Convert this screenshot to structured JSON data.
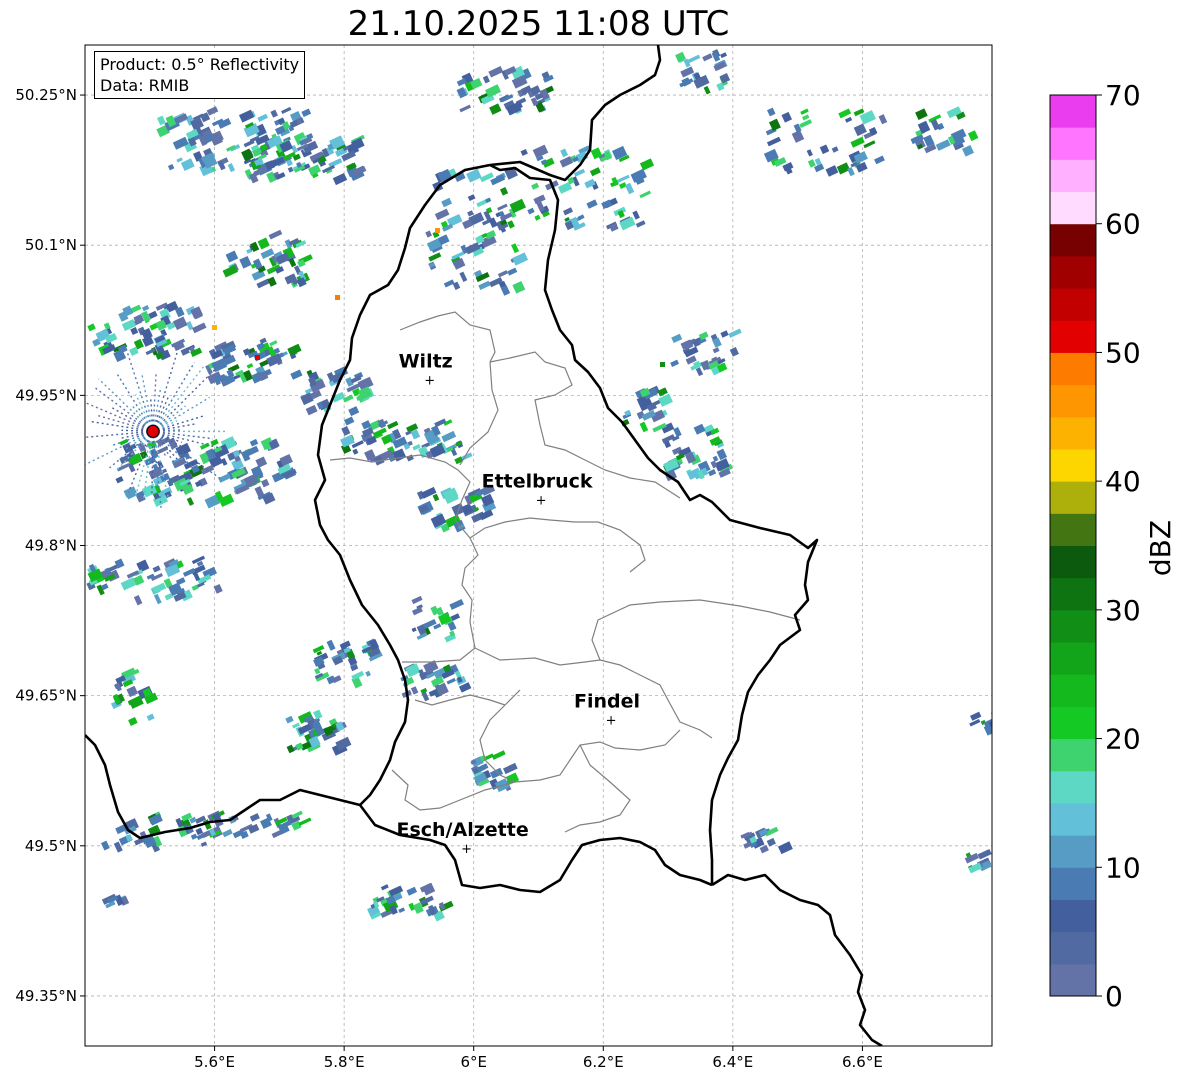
{
  "title": "21.10.2025 11:08 UTC",
  "info": {
    "product": "Product: 0.5° Reflectivity",
    "source": "Data: RMIB"
  },
  "map": {
    "lon_range": [
      5.4,
      6.8
    ],
    "lat_range": [
      49.3,
      50.3
    ],
    "lon_ticks": [
      5.6,
      5.8,
      6.0,
      6.2,
      6.4,
      6.6
    ],
    "lon_tick_labels": [
      "5.6°E",
      "5.8°E",
      "6°E",
      "6.2°E",
      "6.4°E",
      "6.6°E"
    ],
    "lat_ticks": [
      49.35,
      49.5,
      49.65,
      49.8,
      49.95,
      50.1,
      50.25
    ],
    "lat_tick_labels": [
      "49.35°N",
      "49.5°N",
      "49.65°N",
      "49.8°N",
      "49.95°N",
      "50.1°N",
      "50.25°N"
    ],
    "gridlines": true,
    "radar_site": {
      "lon": 5.505,
      "lat": 49.914,
      "color": "#e00000"
    },
    "cities": [
      {
        "name": "Wiltz",
        "lon": 5.932,
        "lat": 49.966
      },
      {
        "name": "Ettelbruck",
        "lon": 6.104,
        "lat": 49.846
      },
      {
        "name": "Findel",
        "lon": 6.212,
        "lat": 49.626
      },
      {
        "name": "Esch/Alzette",
        "lon": 5.989,
        "lat": 49.498
      }
    ]
  },
  "colorbar": {
    "label": "dBZ",
    "min": 0,
    "max": 70,
    "tick_values": [
      0,
      10,
      20,
      30,
      40,
      50,
      60,
      70
    ],
    "tick_labels": [
      "0",
      "10",
      "20",
      "30",
      "40",
      "50",
      "60",
      "70"
    ],
    "colors": [
      "#6373a8",
      "#516aa1",
      "#435f9e",
      "#4a7bb2",
      "#579cc5",
      "#62c0d8",
      "#5cd8c4",
      "#3ed36f",
      "#15c924",
      "#13b91d",
      "#12a519",
      "#108e15",
      "#0e7411",
      "#0b5a0e",
      "#437612",
      "#adb00a",
      "#fdd600",
      "#fdb100",
      "#fd9600",
      "#fd7c00",
      "#e30000",
      "#c20000",
      "#a00000",
      "#770000",
      "#ffdcff",
      "#ffb1ff",
      "#ff75ff",
      "#eb3df0"
    ]
  }
}
